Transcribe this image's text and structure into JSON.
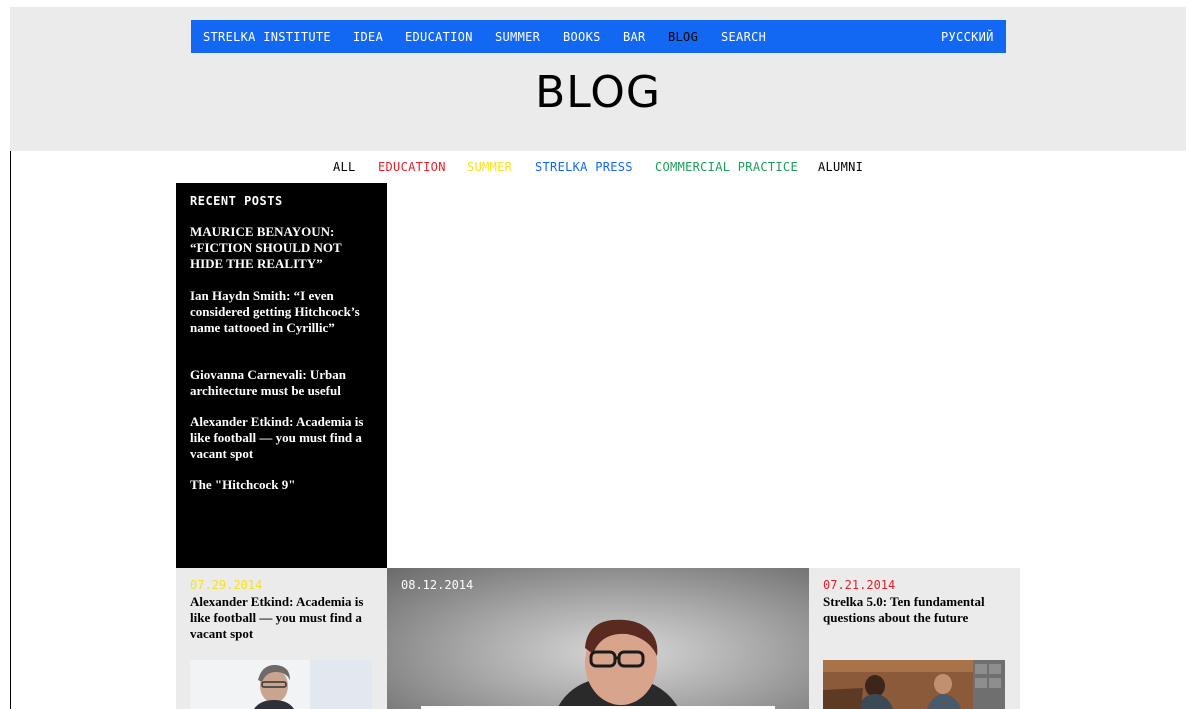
{
  "nav": {
    "items": [
      {
        "label": "STRELKA INSTITUTE",
        "active": false
      },
      {
        "label": "IDEA",
        "active": false
      },
      {
        "label": "EDUCATION",
        "active": false
      },
      {
        "label": "SUMMER",
        "active": false
      },
      {
        "label": "BOOKS",
        "active": false
      },
      {
        "label": "BAR",
        "active": false
      },
      {
        "label": "BLOG",
        "active": true
      },
      {
        "label": "SEARCH",
        "active": false
      }
    ],
    "language": "РУССКИЙ",
    "bg_color": "#1268f3"
  },
  "page_title": "BLOG",
  "filters": [
    {
      "label": "ALL",
      "color": "#000000"
    },
    {
      "label": "EDUCATION",
      "color": "#e8202a"
    },
    {
      "label": "SUMMER",
      "color": "#f5e31b"
    },
    {
      "label": "STRELKA PRESS",
      "color": "#1268f3"
    },
    {
      "label": "COMMERCIAL PRACTICE",
      "color": "#1b9e5a"
    },
    {
      "label": "ALUMNI",
      "color": "#000000"
    }
  ],
  "recent_posts": {
    "title": "RECENT POSTS",
    "items": [
      "MAURICE BENAYOUN: “FICTION SHOULD NOT HIDE THE REALITY”",
      "Ian Haydn Smith: “I even considered getting Hitchcock’s name tattooed in Cyrillic”",
      "Giovanna Carnevali: Urban architecture must be useful",
      "Alexander Etkind: Academia is like football — you must find a vacant spot",
      "The \"Hitchcock 9\""
    ]
  },
  "cards": {
    "left": {
      "date": "07.29.2014",
      "date_color": "#f5e31b",
      "title": "Alexander Etkind: Academia is like football — you must find a vacant spot"
    },
    "feature": {
      "date": "08.12.2014"
    },
    "right": {
      "date": "07.21.2014",
      "date_color": "#e8202a",
      "title": "Strelka 5.0: Ten fundamental questions about the future"
    }
  }
}
